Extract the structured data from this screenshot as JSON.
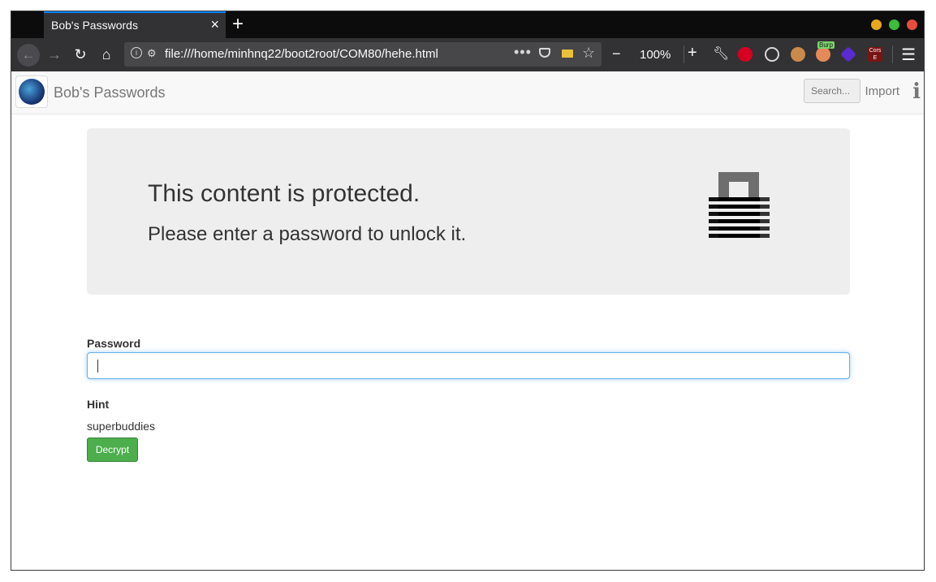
{
  "browser": {
    "tab_title": "Bob's Passwords",
    "tab_close": "×",
    "new_tab": "+",
    "url": "file:///home/minhnq22/boot2root/COM80/hehe.html",
    "url_actions": "•••",
    "zoom_minus": "−",
    "zoom_level": "100%",
    "zoom_plus": "+",
    "burp_tag": "Burp",
    "cors_label": "Cors E",
    "menu": "☰"
  },
  "site": {
    "brand": "Bob's Passwords",
    "search_placeholder": "Search...",
    "import_label": "Import",
    "info_icon": "i"
  },
  "jumbotron": {
    "title": "This content is protected.",
    "subtitle": "Please enter a password to unlock it."
  },
  "form": {
    "password_label": "Password",
    "password_value": "",
    "hint_label": "Hint",
    "hint_value": "superbuddies",
    "decrypt_label": "Decrypt"
  },
  "colors": {
    "accent_tab": "#0a84ff",
    "decrypt_button": "#4cae4c",
    "input_focus": "#66afe9"
  },
  "icons": [
    "back-icon",
    "forward-icon",
    "reload-icon",
    "home-icon",
    "info-icon",
    "permissions-icon",
    "more-icon",
    "pocket-icon",
    "folder-icon",
    "star-icon",
    "wrench-icon",
    "stop-icon",
    "cookie-icon",
    "palette-icon",
    "burp-icon",
    "cube-icon",
    "cors-icon",
    "menu-icon",
    "lock-icon"
  ]
}
